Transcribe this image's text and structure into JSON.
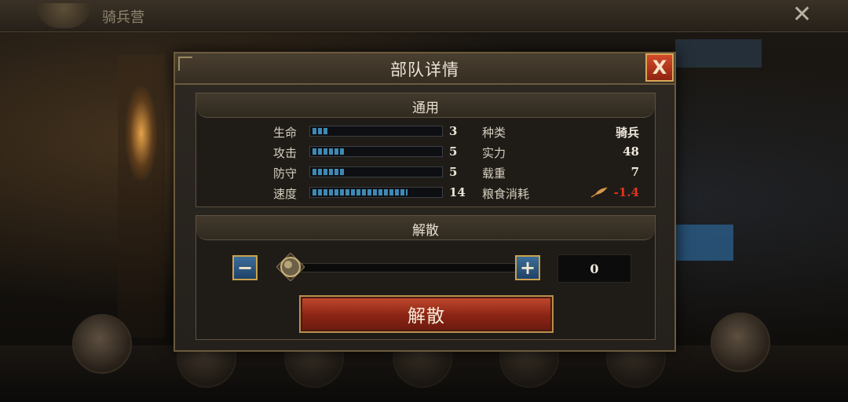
{
  "background": {
    "title": "骑兵营",
    "close_glyph": "✕"
  },
  "dialog": {
    "title": "部队详情",
    "close_glyph": "X",
    "general": {
      "heading": "通用",
      "stats": [
        {
          "label": "生命",
          "value": "3"
        },
        {
          "label": "攻击",
          "value": "5"
        },
        {
          "label": "防守",
          "value": "5"
        },
        {
          "label": "速度",
          "value": "14"
        }
      ],
      "info": [
        {
          "label": "种类",
          "value": "骑兵"
        },
        {
          "label": "实力",
          "value": "48"
        },
        {
          "label": "载重",
          "value": "7"
        },
        {
          "label": "粮食消耗",
          "value": "-1.4"
        }
      ]
    },
    "disband": {
      "heading": "解散",
      "minus": "−",
      "plus": "+",
      "quantity": "0",
      "button_label": "解散"
    }
  },
  "colors": {
    "accent_gold": "#c9a24e",
    "bar_blue": "#3e89b4",
    "negative_red": "#e0341c",
    "button_red": "#c34a2e"
  },
  "icons": [
    "close-icon",
    "feather-icon",
    "minus-icon",
    "plus-icon",
    "slider-knob-icon"
  ]
}
